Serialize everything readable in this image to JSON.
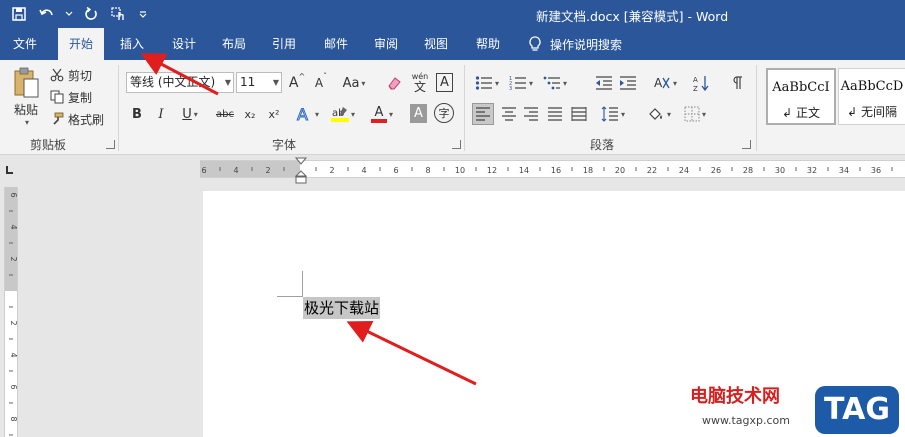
{
  "window": {
    "title": "新建文档.docx [兼容模式] - Word"
  },
  "tabs": [
    {
      "id": "file",
      "label": "文件"
    },
    {
      "id": "home",
      "label": "开始"
    },
    {
      "id": "insert",
      "label": "插入"
    },
    {
      "id": "design",
      "label": "设计"
    },
    {
      "id": "layout",
      "label": "布局"
    },
    {
      "id": "references",
      "label": "引用"
    },
    {
      "id": "mailings",
      "label": "邮件"
    },
    {
      "id": "review",
      "label": "审阅"
    },
    {
      "id": "view",
      "label": "视图"
    },
    {
      "id": "help",
      "label": "帮助"
    }
  ],
  "tell_me": "操作说明搜索",
  "clipboard": {
    "paste": "粘贴",
    "cut": "剪切",
    "copy": "复制",
    "format_painter": "格式刷",
    "group_label": "剪贴板"
  },
  "font": {
    "font_name": "等线 (中文正文)",
    "font_size": "11",
    "grow": "A",
    "shrink": "A",
    "change_case": "Aa",
    "phonetic_top": "wén",
    "phonetic_bottom": "文",
    "char_border": "A",
    "bold": "B",
    "italic": "I",
    "underline": "U",
    "strike": "abc",
    "subscript": "x₂",
    "superscript": "x²",
    "color_a": "A",
    "shading_a": "A",
    "enclose": "字",
    "group_label": "字体"
  },
  "paragraph": {
    "group_label": "段落"
  },
  "styles": [
    {
      "sample": "AaBbCcI",
      "name": "正文"
    },
    {
      "sample": "AaBbCcD",
      "name": "无间隔"
    }
  ],
  "document": {
    "text": "极光下载站"
  },
  "hruler_labels": [
    "6",
    "4",
    "2",
    "",
    "2",
    "4",
    "6",
    "8",
    "10",
    "12",
    "14",
    "16",
    "18",
    "20",
    "22",
    "24",
    "26",
    "28",
    "30",
    "32",
    "34",
    "36"
  ],
  "vruler_labels": [
    "6",
    "4",
    "2",
    "",
    "2",
    "4",
    "6",
    "8"
  ],
  "watermark": {
    "name": "电脑技术网",
    "url": "www.tagxp.com",
    "tag": "TAG"
  },
  "colors": {
    "accent": "#2b579a",
    "arrow": "#e01e1e",
    "font_color": "#e02020",
    "highlight": "#ffff00"
  }
}
